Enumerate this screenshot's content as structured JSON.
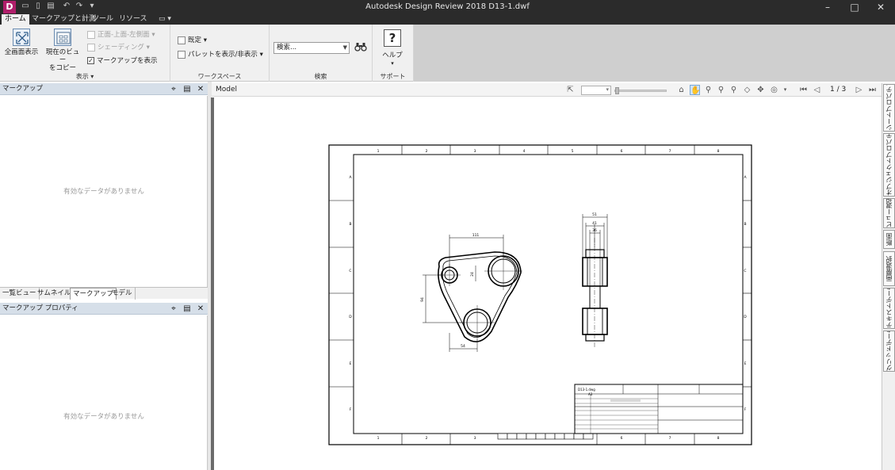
{
  "app": {
    "title": "Autodesk Design Review 2018   D13-1.dwf",
    "logo_letter": "D",
    "window_controls": [
      "minimize-icon",
      "maximize-icon",
      "close-icon"
    ]
  },
  "quick_access": [
    "open-icon",
    "save-icon",
    "print-icon",
    "undo-icon",
    "redo-icon",
    "customize-icon"
  ],
  "ribbon_tabs": [
    "ホーム",
    "マークアップと計測",
    "ツール",
    "リソース"
  ],
  "ribbon": {
    "view_group": {
      "label": "表示 ▾",
      "fullscreen": "全画面表示",
      "copy_view_line1": "現在のビュー",
      "copy_view_line2": "をコピー",
      "views_dropdown": "正面-上面-左側面 ▾",
      "shading": "シェーディング ▾",
      "show_markups": "マークアップを表示",
      "show_markups_checked": true
    },
    "workspace_group": {
      "label": "ワークスペース",
      "default": "既定 ▾",
      "palette_toggle": "パレットを表示/非表示 ▾"
    },
    "search_group": {
      "label": "検索",
      "search_placeholder": "検索..."
    },
    "support_group": {
      "label": "サポート",
      "help": "ヘルプ"
    }
  },
  "left_panels": {
    "markup": {
      "title": "マークアップ",
      "empty_message": "有効なデータがありません"
    },
    "panel_tabs": [
      "一覧ビュー",
      "サムネイル",
      "マークアップ",
      "モデル"
    ],
    "active_panel_tab": "マークアップ",
    "markup_properties": {
      "title": "マークアップ プロパティ",
      "empty_message": "有効なデータがありません"
    }
  },
  "canvas": {
    "tab_label": "Model",
    "page_indicator": "1 / 3",
    "nav_tools": [
      "select-icon",
      "home-icon",
      "pan-icon",
      "zoom-icon",
      "zoom-window-icon",
      "zoom-extents-icon",
      "orbit-icon",
      "walk-icon",
      "steering-wheel-icon",
      "first-page-icon",
      "previous-page-icon",
      "next-page-icon",
      "last-page-icon"
    ]
  },
  "drawing": {
    "zone_numbers": [
      "1",
      "2",
      "3",
      "4",
      "5",
      "6",
      "7",
      "8"
    ],
    "zone_letters": [
      "A",
      "B",
      "C",
      "D",
      "E",
      "F"
    ],
    "dims": {
      "top_front": "51",
      "mid_front": "41",
      "inner_front": "36",
      "top_plate": "111",
      "bottom_plate": "54",
      "side_plate": "94",
      "small_v": "24"
    },
    "title_block": {
      "drawing_no": "D13-1.dwg",
      "size": "A3"
    }
  },
  "side_tabs": [
    "シートプロパティ",
    "オブジェクトプロパティ",
    "ビュー選択",
    "断面",
    "画層選択",
    "テキストデータ",
    "グリッドデータ"
  ]
}
